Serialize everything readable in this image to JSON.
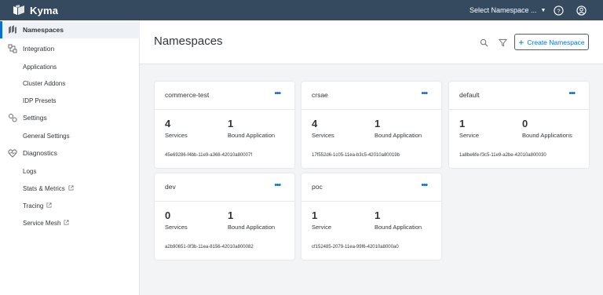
{
  "app": {
    "title": "Kyma"
  },
  "topbar": {
    "namespace_select": "Select Namespace ...",
    "help_icon": "help-icon",
    "user_icon": "user-icon"
  },
  "sidebar": {
    "items": [
      {
        "label": "Namespaces",
        "icon": "namespaces-icon",
        "active": true
      },
      {
        "label": "Integration",
        "icon": "integration-icon"
      },
      {
        "label": "Applications"
      },
      {
        "label": "Cluster Addons"
      },
      {
        "label": "IDP Presets"
      },
      {
        "label": "Settings",
        "icon": "settings-icon"
      },
      {
        "label": "General Settings"
      },
      {
        "label": "Diagnostics",
        "icon": "diagnostics-icon"
      },
      {
        "label": "Logs"
      },
      {
        "label": "Stats & Metrics",
        "external": true
      },
      {
        "label": "Tracing",
        "external": true
      },
      {
        "label": "Service Mesh",
        "external": true
      }
    ]
  },
  "header": {
    "title": "Namespaces",
    "create_label": "Create Namespace"
  },
  "cards": [
    {
      "name": "commerce-test",
      "services": "4",
      "services_label": "Services",
      "apps": "1",
      "apps_label": "Bound Application",
      "uid": "45e69286-f4bb-11e9-a368-42010a80007f"
    },
    {
      "name": "crsae",
      "services": "4",
      "services_label": "Services",
      "apps": "1",
      "apps_label": "Bound Application",
      "uid": "17f552d6-1c05-11ea-b3c5-42010a80019b"
    },
    {
      "name": "default",
      "services": "1",
      "services_label": "Service",
      "apps": "0",
      "apps_label": "Bound Applications",
      "uid": "1a8be6fe-f3c5-11e9-a2be-42010a800030"
    },
    {
      "name": "dev",
      "services": "0",
      "services_label": "Services",
      "apps": "1",
      "apps_label": "Bound Application",
      "uid": "a2b90651-0f3b-11ea-8156-42010a800082"
    },
    {
      "name": "poc",
      "services": "1",
      "services_label": "Service",
      "apps": "1",
      "apps_label": "Bound Application",
      "uid": "cf152485-2079-11ea-99f6-42010a8000a0"
    }
  ],
  "colors": {
    "shell": "#354a5f",
    "accent": "#0a6ed1",
    "background": "#f3f4f5"
  }
}
